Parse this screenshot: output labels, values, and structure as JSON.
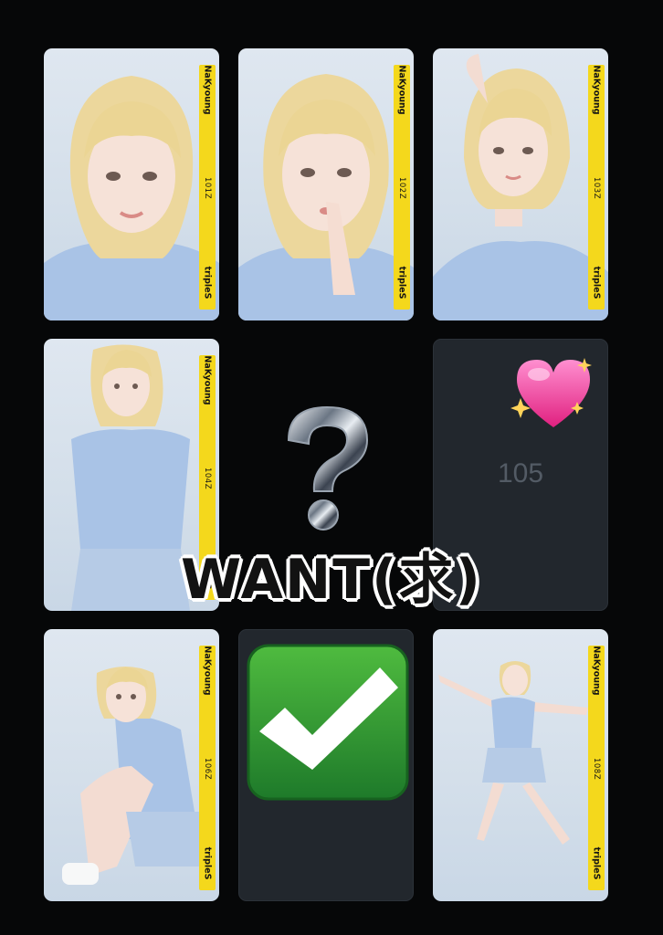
{
  "cards": [
    {
      "member": "NaKyoung",
      "serial": "101Z",
      "group": "tripleS",
      "pose": "portrait-smile"
    },
    {
      "member": "NaKyoung",
      "serial": "102Z",
      "group": "tripleS",
      "pose": "finger-on-lips"
    },
    {
      "member": "NaKyoung",
      "serial": "103Z",
      "group": "tripleS",
      "pose": "hand-on-head"
    },
    {
      "member": "NaKyoung",
      "serial": "104Z",
      "group": "tripleS",
      "pose": "standing"
    },
    {
      "placeholder_number": "105"
    },
    {
      "member": "NaKyoung",
      "serial": "106Z",
      "group": "tripleS",
      "pose": "sitting"
    },
    {
      "status": "collected"
    },
    {
      "member": "NaKyoung",
      "serial": "108Z",
      "group": "tripleS",
      "pose": "jumping"
    }
  ],
  "overlay": {
    "want_text": "WANT(求)",
    "stickers": [
      "question-mark",
      "sparkling-heart",
      "check-mark"
    ]
  },
  "colors": {
    "background": "#060708",
    "strip": "#f4d81c",
    "empty_slot": "#22272d",
    "check_green": "#2e9a35"
  }
}
